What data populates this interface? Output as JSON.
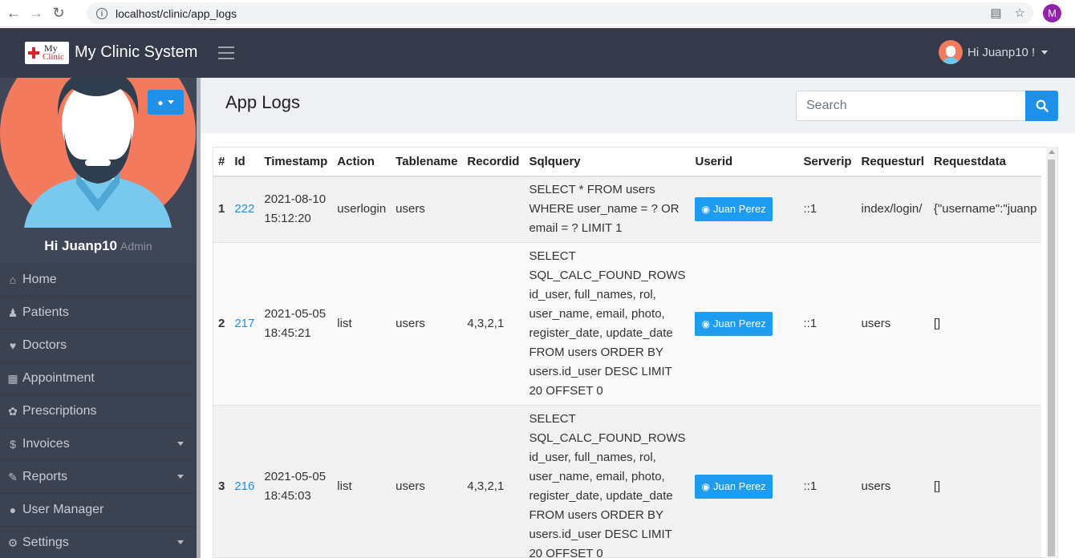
{
  "browser": {
    "url": "localhost/clinic/app_logs",
    "profile_initial": "M"
  },
  "navbar": {
    "logo_top": "My",
    "logo_bottom": "Clinic",
    "brand": "My Clinic System",
    "greeting": "Hi Juanp10 !"
  },
  "sidebar": {
    "user_name": "Hi Juanp10",
    "user_role": "Admin",
    "items": [
      {
        "label": "Home",
        "icon": "home-icon"
      },
      {
        "label": "Patients",
        "icon": "user-plus-icon"
      },
      {
        "label": "Doctors",
        "icon": "heartbeat-icon"
      },
      {
        "label": "Appointment",
        "icon": "calendar-icon"
      },
      {
        "label": "Prescriptions",
        "icon": "pills-icon"
      },
      {
        "label": "Invoices",
        "icon": "dollar-icon"
      },
      {
        "label": "Reports",
        "icon": "edit-icon"
      },
      {
        "label": "User Manager",
        "icon": "users-icon"
      },
      {
        "label": "Settings",
        "icon": "gear-icon"
      }
    ]
  },
  "page": {
    "title": "App Logs",
    "search_placeholder": "Search"
  },
  "table": {
    "headers": [
      "#",
      "Id",
      "Timestamp",
      "Action",
      "Tablename",
      "Recordid",
      "Sqlquery",
      "Userid",
      "Serverip",
      "Requesturl",
      "Requestdata"
    ],
    "rows": [
      {
        "num": "1",
        "id": "222",
        "ts1": "2021-08-10",
        "ts2": "15:12:20",
        "action": "userlogin",
        "table": "users",
        "recordid": "",
        "sql": "SELECT * FROM users WHERE user_name = ? OR email = ? LIMIT 1",
        "user": "Juan Perez",
        "serverip": "::1",
        "url": "index/login/",
        "data": "{\"username\":\"juanp"
      },
      {
        "num": "2",
        "id": "217",
        "ts1": "2021-05-05",
        "ts2": "18:45:21",
        "action": "list",
        "table": "users",
        "recordid": "4,3,2,1",
        "sql": "SELECT SQL_CALC_FOUND_ROWS id_user, full_names, rol, user_name, email, photo, register_date, update_date FROM users ORDER BY users.id_user DESC LIMIT 20 OFFSET 0",
        "user": "Juan Perez",
        "serverip": "::1",
        "url": "users",
        "data": "[]"
      },
      {
        "num": "3",
        "id": "216",
        "ts1": "2021-05-05",
        "ts2": "18:45:03",
        "action": "list",
        "table": "users",
        "recordid": "4,3,2,1",
        "sql": "SELECT SQL_CALC_FOUND_ROWS id_user, full_names, rol, user_name, email, photo, register_date, update_date FROM users ORDER BY users.id_user DESC LIMIT 20 OFFSET 0",
        "user": "Juan Perez",
        "serverip": "::1",
        "url": "users",
        "data": "[]"
      }
    ]
  }
}
